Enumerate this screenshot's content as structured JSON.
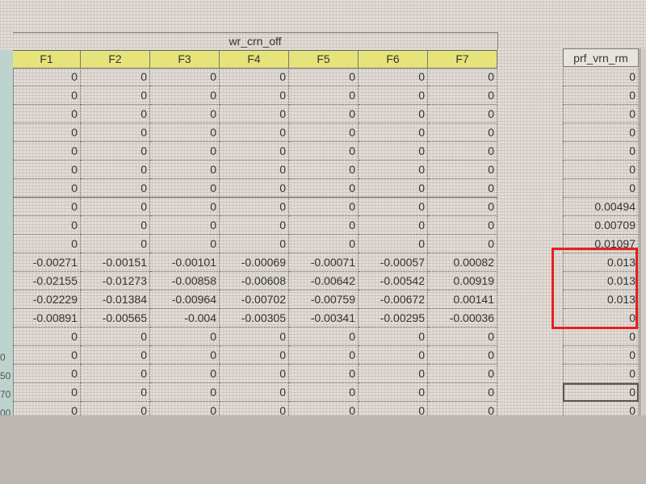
{
  "main_table": {
    "title": "wr_crn_off",
    "columns": [
      "F1",
      "F2",
      "F3",
      "F4",
      "F5",
      "F6",
      "F7"
    ],
    "rows": [
      [
        "0",
        "0",
        "0",
        "0",
        "0",
        "0",
        "0"
      ],
      [
        "0",
        "0",
        "0",
        "0",
        "0",
        "0",
        "0"
      ],
      [
        "0",
        "0",
        "0",
        "0",
        "0",
        "0",
        "0"
      ],
      [
        "0",
        "0",
        "0",
        "0",
        "0",
        "0",
        "0"
      ],
      [
        "0",
        "0",
        "0",
        "0",
        "0",
        "0",
        "0"
      ],
      [
        "0",
        "0",
        "0",
        "0",
        "0",
        "0",
        "0"
      ],
      [
        "0",
        "0",
        "0",
        "0",
        "0",
        "0",
        "0"
      ],
      [
        "0",
        "0",
        "0",
        "0",
        "0",
        "0",
        "0"
      ],
      [
        "0",
        "0",
        "0",
        "0",
        "0",
        "0",
        "0"
      ],
      [
        "0",
        "0",
        "0",
        "0",
        "0",
        "0",
        "0"
      ],
      [
        "-0.00271",
        "-0.00151",
        "-0.00101",
        "-0.00069",
        "-0.00071",
        "-0.00057",
        "0.00082"
      ],
      [
        "-0.02155",
        "-0.01273",
        "-0.00858",
        "-0.00608",
        "-0.00642",
        "-0.00542",
        "0.00919"
      ],
      [
        "-0.02229",
        "-0.01384",
        "-0.00964",
        "-0.00702",
        "-0.00759",
        "-0.00672",
        "0.00141"
      ],
      [
        "-0.00891",
        "-0.00565",
        "-0.004",
        "-0.00305",
        "-0.00341",
        "-0.00295",
        "-0.00036"
      ],
      [
        "0",
        "0",
        "0",
        "0",
        "0",
        "0",
        "0"
      ],
      [
        "0",
        "0",
        "0",
        "0",
        "0",
        "0",
        "0"
      ],
      [
        "0",
        "0",
        "0",
        "0",
        "0",
        "0",
        "0"
      ],
      [
        "0",
        "0",
        "0",
        "0",
        "0",
        "0",
        "0"
      ],
      [
        "0",
        "0",
        "0",
        "0",
        "0",
        "0",
        "0"
      ]
    ]
  },
  "right_table": {
    "title": "prf_vrn_rm",
    "values": [
      "0",
      "0",
      "0",
      "0",
      "0",
      "0",
      "0",
      "0.00494",
      "0.00709",
      "0.01097",
      "0.013",
      "0.013",
      "0.013",
      "0",
      "0",
      "0",
      "0",
      "0",
      "0"
    ]
  },
  "row_header_labels": [
    "0",
    "50",
    "70",
    "00"
  ],
  "highlight_color": "#e8201c",
  "header_fill_color": "#e6e37a"
}
